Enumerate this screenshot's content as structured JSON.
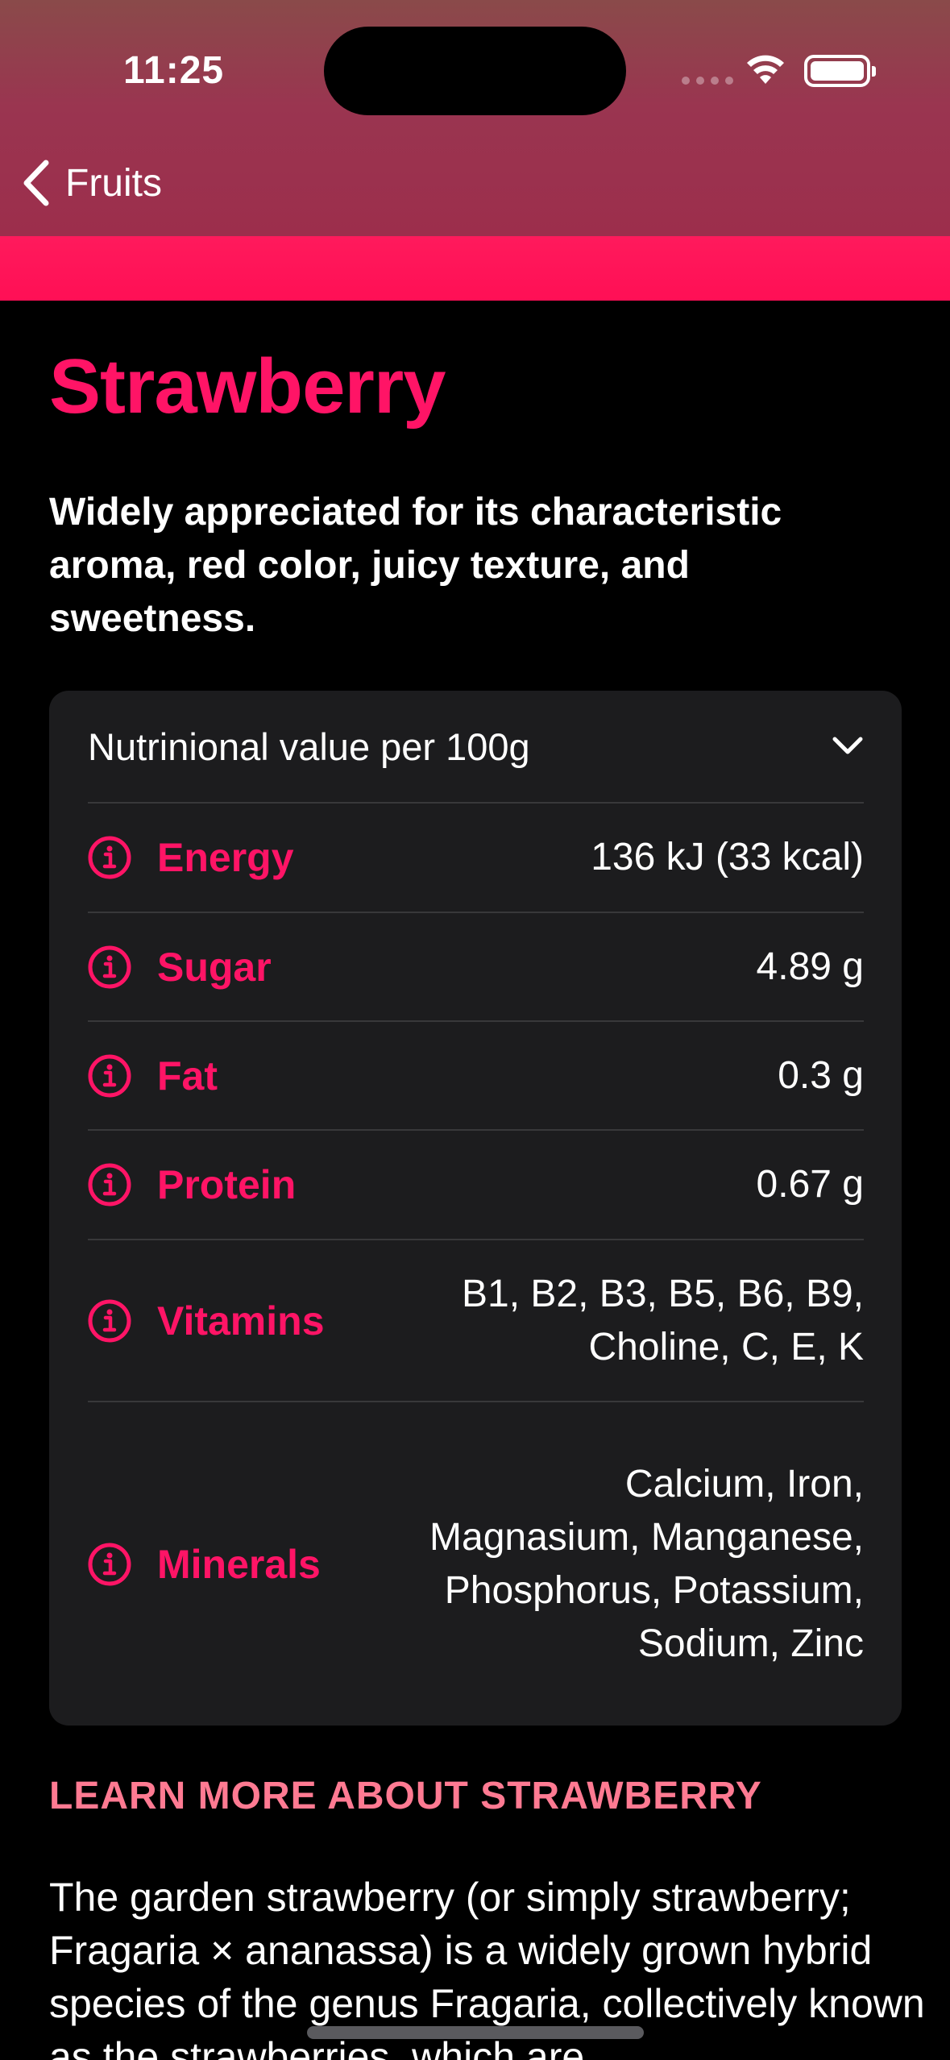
{
  "status_bar": {
    "time": "11:25"
  },
  "nav": {
    "back_label": "Fruits"
  },
  "colors": {
    "accent": "#ff1466",
    "header_top": "#8a4a4a",
    "header_bottom": "#9c2e4c",
    "strip": "#ff1a5c",
    "card_bg": "#1c1c1e"
  },
  "fruit": {
    "title": "Strawberry",
    "subtitle": "Widely appreciated for its characteristic aroma,  red color, juicy texture, and sweetness."
  },
  "nutrition": {
    "header_label": "Nutrinional value per 100g",
    "expanded": true,
    "rows": [
      {
        "label": "Energy",
        "value": "136 kJ (33 kcal)",
        "icon": "info-circle-icon"
      },
      {
        "label": "Sugar",
        "value": "4.89 g",
        "icon": "info-circle-icon"
      },
      {
        "label": "Fat",
        "value": "0.3 g",
        "icon": "info-circle-icon"
      },
      {
        "label": "Protein",
        "value": "0.67 g",
        "icon": "info-circle-icon"
      },
      {
        "label": "Vitamins",
        "value": "B1, B2, B3, B5, B6, B9, Choline, C, E, K",
        "icon": "info-circle-icon"
      },
      {
        "label": "Minerals",
        "value": "Calcium, Iron, Magnasium, Manganese, Phosphorus, Potassium, Sodium, Zinc",
        "icon": "info-circle-icon"
      }
    ]
  },
  "learn_more": {
    "heading": "LEARN MORE ABOUT STRAWBERRY",
    "body": "The garden strawberry (or simply strawberry; Fragaria × ananassa) is a widely grown hybrid species of the genus Fragaria, collectively known as the strawberries, which are"
  }
}
